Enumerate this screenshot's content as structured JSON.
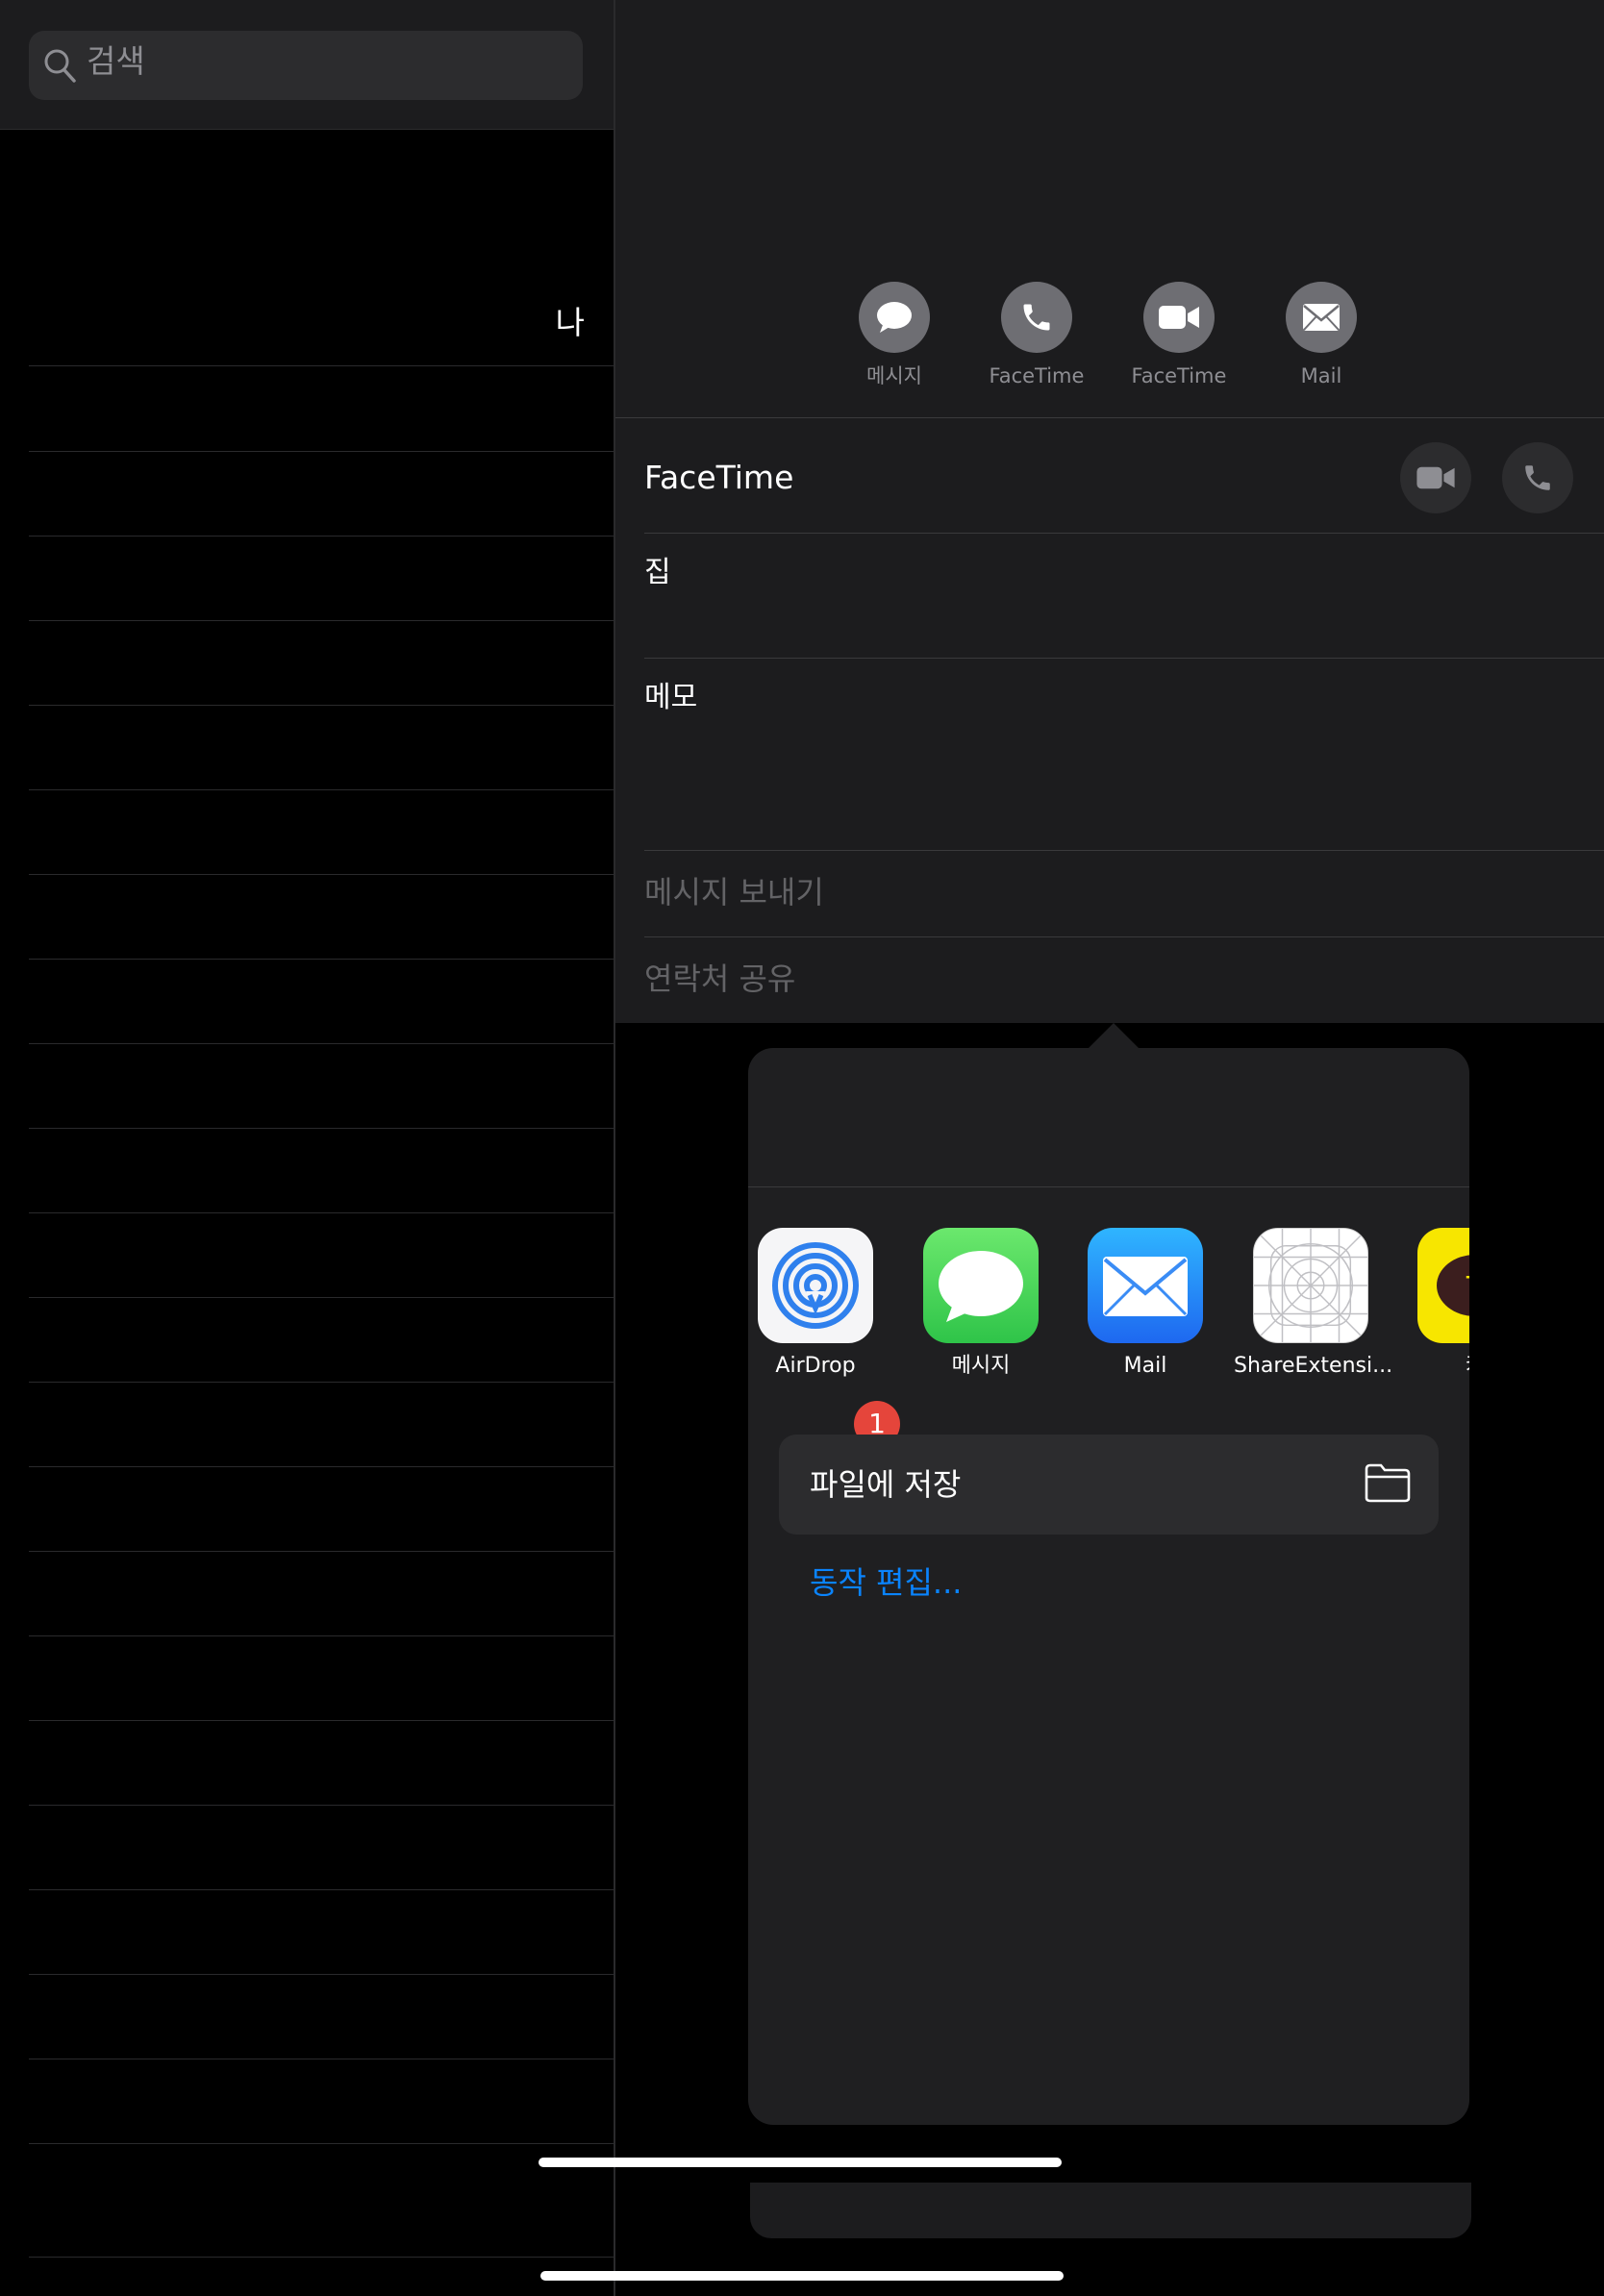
{
  "search": {
    "placeholder": "검색"
  },
  "contacts_list": {
    "me_label": "나"
  },
  "actions": [
    {
      "label": "메시지",
      "icon": "message-icon"
    },
    {
      "label": "FaceTime",
      "icon": "phone-icon"
    },
    {
      "label": "FaceTime",
      "icon": "video-icon"
    },
    {
      "label": "Mail",
      "icon": "mail-icon"
    }
  ],
  "detail": {
    "facetime_title": "FaceTime",
    "home_label": "집",
    "memo_label": "메모",
    "send_message": "메시지 보내기",
    "share_contact": "연락처 공유"
  },
  "share_sheet": {
    "apps": [
      {
        "label": "AirDrop",
        "icon": "airdrop-icon",
        "badge": "1"
      },
      {
        "label": "메시지",
        "icon": "messages-app-icon"
      },
      {
        "label": "Mail",
        "icon": "mail-app-icon"
      },
      {
        "label": "ShareExtensi...",
        "icon": "share-extension-icon"
      },
      {
        "label": "카",
        "icon": "kakaotalk-icon"
      }
    ],
    "save_to_files": "파일에 저장",
    "edit_actions": "동작 편집..."
  },
  "colors": {
    "accent": "#0a84ff",
    "badge": "#e5453b",
    "messages_green": "#34c759",
    "mail_blue": "#1e7bf0",
    "kakao_yellow": "#f7e600"
  }
}
